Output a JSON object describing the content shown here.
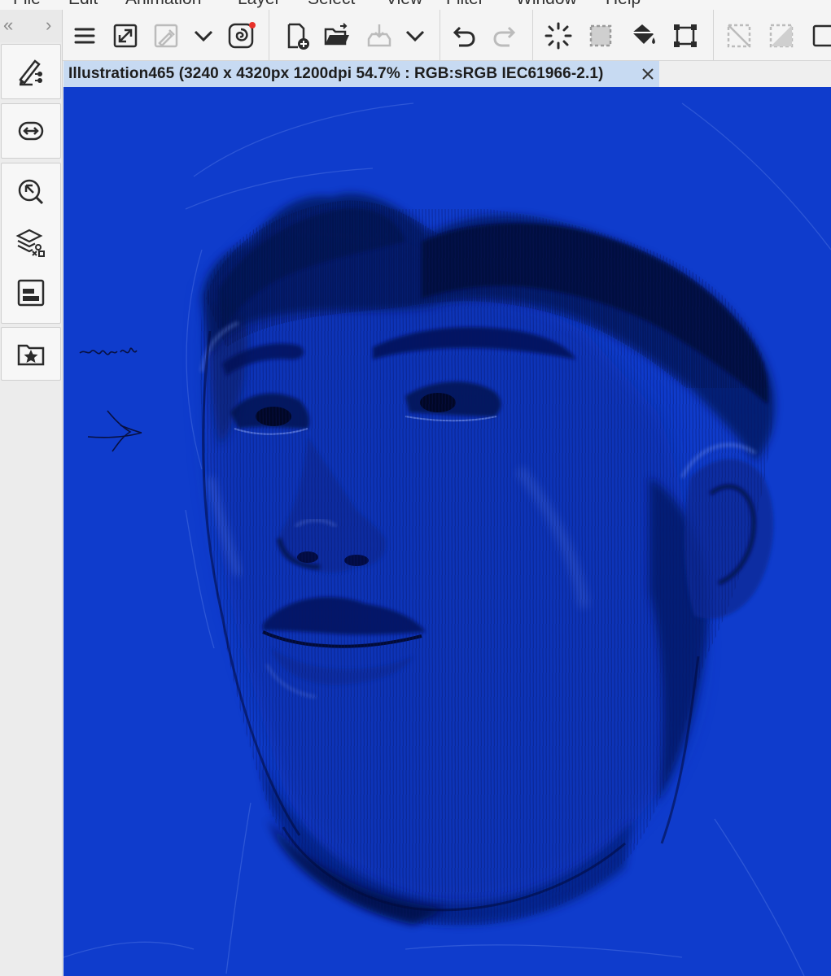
{
  "app": {
    "menu": [
      "File",
      "Edit",
      "Animation",
      "Layer",
      "Select",
      "View",
      "Filter",
      "Window",
      "Help"
    ]
  },
  "toolbar": {
    "buttons": [
      {
        "icon": "menu-icon"
      },
      {
        "icon": "resize-icon"
      },
      {
        "icon": "eyedropper-icon"
      },
      {
        "icon": "chevron-down-icon"
      },
      {
        "icon": "spiral-logo-icon"
      },
      {
        "icon": "new-document-icon"
      },
      {
        "icon": "open-folder-icon"
      },
      {
        "icon": "save-icon"
      },
      {
        "icon": "chevron-down-icon"
      },
      {
        "icon": "undo-icon"
      },
      {
        "icon": "redo-icon"
      },
      {
        "icon": "loading-spinner-icon"
      },
      {
        "icon": "selection-icon"
      },
      {
        "icon": "fill-bucket-icon"
      },
      {
        "icon": "transform-icon"
      },
      {
        "icon": "clear-selection-icon"
      },
      {
        "icon": "invert-selection-icon"
      },
      {
        "icon": "panel-icon"
      }
    ]
  },
  "dock": {
    "collapse_label": "«",
    "expand_label": "›",
    "items": [
      {
        "icon": "sub-tool-icon"
      },
      {
        "icon": "navigator-icon"
      },
      {
        "icon": "search-layer-icon"
      },
      {
        "icon": "layer-properties-icon"
      },
      {
        "icon": "history-icon"
      },
      {
        "icon": "materials-icon"
      }
    ]
  },
  "document": {
    "tab_title": "Illustration465 (3240 x 4320px 1200dpi 54.7% : RGB:sRGB IEC61966-2.1)",
    "close_label": "✕"
  },
  "canvas": {
    "background_color": "#0f3ccc",
    "content": "sketch-portrait"
  }
}
